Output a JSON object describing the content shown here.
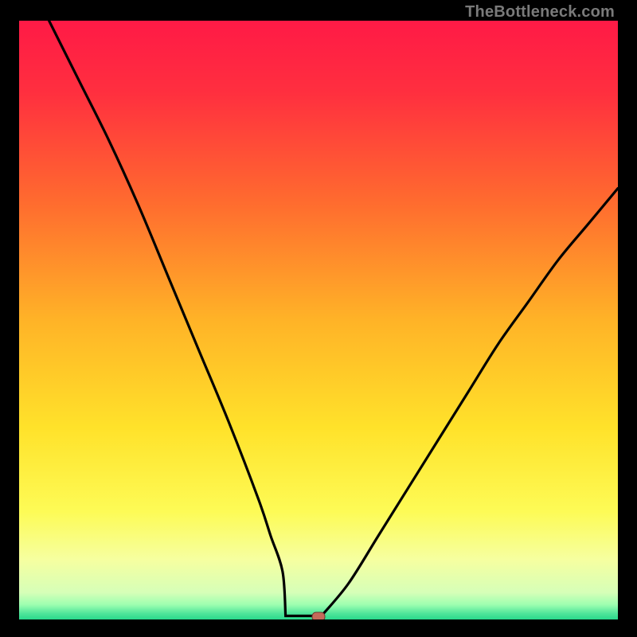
{
  "watermark": "TheBottleneck.com",
  "colors": {
    "gradient_stops": [
      {
        "offset": 0.0,
        "color": "#ff1a46"
      },
      {
        "offset": 0.12,
        "color": "#ff2f3f"
      },
      {
        "offset": 0.3,
        "color": "#ff6a2f"
      },
      {
        "offset": 0.5,
        "color": "#ffb327"
      },
      {
        "offset": 0.68,
        "color": "#ffe22a"
      },
      {
        "offset": 0.82,
        "color": "#fdfb56"
      },
      {
        "offset": 0.9,
        "color": "#f6ffa0"
      },
      {
        "offset": 0.955,
        "color": "#d6ffb8"
      },
      {
        "offset": 0.975,
        "color": "#9effb0"
      },
      {
        "offset": 0.99,
        "color": "#4fe59a"
      },
      {
        "offset": 1.0,
        "color": "#29d98c"
      }
    ],
    "curve": "#000000",
    "marker_fill": "#c46a5a",
    "marker_stroke": "#6d3b30"
  },
  "chart_data": {
    "type": "line",
    "title": "",
    "xlabel": "",
    "ylabel": "",
    "xlim": [
      0,
      100
    ],
    "ylim": [
      0,
      100
    ],
    "series": [
      {
        "name": "bottleneck-curve",
        "x": [
          5,
          10,
          15,
          20,
          25,
          30,
          35,
          40,
          42,
          44,
          46,
          48,
          50,
          55,
          60,
          65,
          70,
          75,
          80,
          85,
          90,
          95,
          100
        ],
        "y": [
          100,
          90,
          80,
          69,
          57,
          45,
          33,
          20,
          14,
          8,
          3,
          1,
          0,
          6,
          14,
          22,
          30,
          38,
          46,
          53,
          60,
          66,
          72
        ]
      }
    ],
    "flat_segment": {
      "x_start": 44.5,
      "x_end": 50.5,
      "y": 0.6
    },
    "marker": {
      "x": 50,
      "y": 0.4,
      "label": "optimal-point"
    }
  }
}
